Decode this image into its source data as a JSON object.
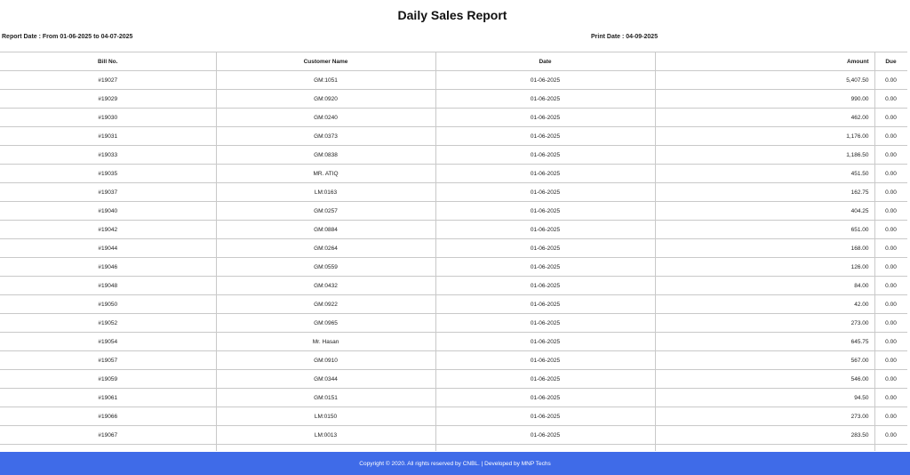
{
  "report": {
    "title": "Daily Sales Report",
    "report_date_label": "Report Date : From 01-06-2025 to 04-07-2025",
    "print_date_label": "Print Date : 04-09-2025"
  },
  "table": {
    "columns": [
      "Bill No.",
      "Customer Name",
      "Date",
      "Amount",
      "Due"
    ],
    "rows": [
      [
        "#19027",
        "GM:1051",
        "01-06-2025",
        "5,407.50",
        "0.00"
      ],
      [
        "#19029",
        "GM:0920",
        "01-06-2025",
        "990.00",
        "0.00"
      ],
      [
        "#19030",
        "GM:0240",
        "01-06-2025",
        "462.00",
        "0.00"
      ],
      [
        "#19031",
        "GM:0373",
        "01-06-2025",
        "1,176.00",
        "0.00"
      ],
      [
        "#19033",
        "GM:0838",
        "01-06-2025",
        "1,186.50",
        "0.00"
      ],
      [
        "#19035",
        "MR. ATIQ",
        "01-06-2025",
        "451.50",
        "0.00"
      ],
      [
        "#19037",
        "LM:0163",
        "01-06-2025",
        "162.75",
        "0.00"
      ],
      [
        "#19040",
        "GM:0257",
        "01-06-2025",
        "404.25",
        "0.00"
      ],
      [
        "#19042",
        "GM:0884",
        "01-06-2025",
        "651.00",
        "0.00"
      ],
      [
        "#19044",
        "GM:0264",
        "01-06-2025",
        "168.00",
        "0.00"
      ],
      [
        "#19046",
        "GM:0559",
        "01-06-2025",
        "126.00",
        "0.00"
      ],
      [
        "#19048",
        "GM:0432",
        "01-06-2025",
        "84.00",
        "0.00"
      ],
      [
        "#19050",
        "GM:0922",
        "01-06-2025",
        "42.00",
        "0.00"
      ],
      [
        "#19052",
        "GM:0965",
        "01-06-2025",
        "273.00",
        "0.00"
      ],
      [
        "#19054",
        "Mr. Hasan",
        "01-06-2025",
        "645.75",
        "0.00"
      ],
      [
        "#19057",
        "GM:0910",
        "01-06-2025",
        "567.00",
        "0.00"
      ],
      [
        "#19059",
        "GM:0344",
        "01-06-2025",
        "546.00",
        "0.00"
      ],
      [
        "#19061",
        "GM:0151",
        "01-06-2025",
        "94.50",
        "0.00"
      ],
      [
        "#19066",
        "LM:0150",
        "01-06-2025",
        "273.00",
        "0.00"
      ],
      [
        "#19067",
        "LM:0013",
        "01-06-2025",
        "283.50",
        "0.00"
      ],
      [
        "",
        "",
        "",
        "",
        ""
      ]
    ]
  },
  "footer": {
    "text": "Copyright © 2020. All rights reserved by CNBL. | Developed by MNP Techs"
  },
  "colors": {
    "footer_bg": "#3f6be8"
  }
}
